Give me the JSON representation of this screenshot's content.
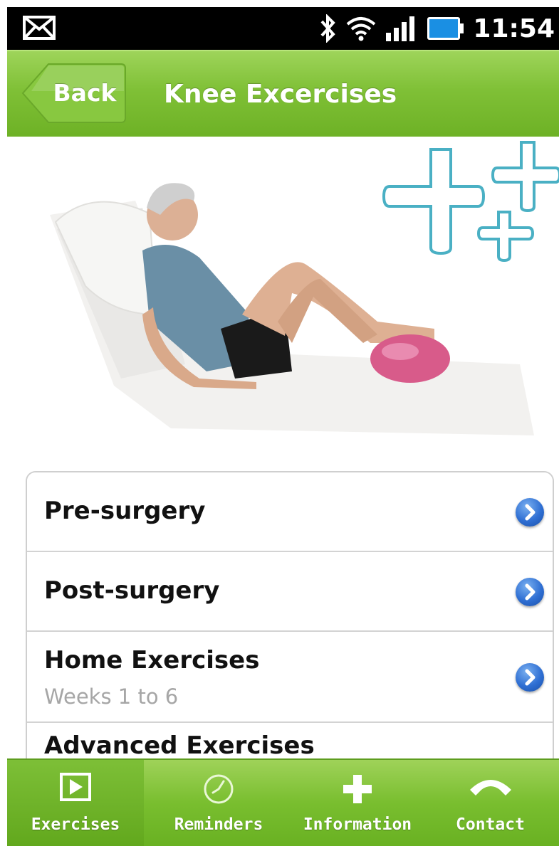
{
  "status_bar": {
    "time": "11:54",
    "icons": [
      "mail-icon",
      "bluetooth-icon",
      "wifi-icon",
      "signal-icon",
      "battery-icon"
    ]
  },
  "header": {
    "back_label": "Back",
    "title": "Knee Excercises"
  },
  "hero": {
    "image": "illustration-man-exercise-ball"
  },
  "list": {
    "items": [
      {
        "title": "Pre-surgery",
        "subtitle": ""
      },
      {
        "title": "Post-surgery",
        "subtitle": ""
      },
      {
        "title": "Home Exercises",
        "subtitle": "Weeks 1 to 6"
      },
      {
        "title": "Advanced Exercises",
        "subtitle": ""
      }
    ]
  },
  "tabbar": {
    "tabs": [
      {
        "label": "Exercises",
        "icon": "play-icon",
        "active": true
      },
      {
        "label": "Reminders",
        "icon": "clock-icon",
        "active": false
      },
      {
        "label": "Information",
        "icon": "cross-icon",
        "active": false
      },
      {
        "label": "Contact",
        "icon": "phone-icon",
        "active": false
      }
    ]
  },
  "colors": {
    "accent_green": "#7fc036",
    "disclosure_blue": "#2f6fd3"
  }
}
